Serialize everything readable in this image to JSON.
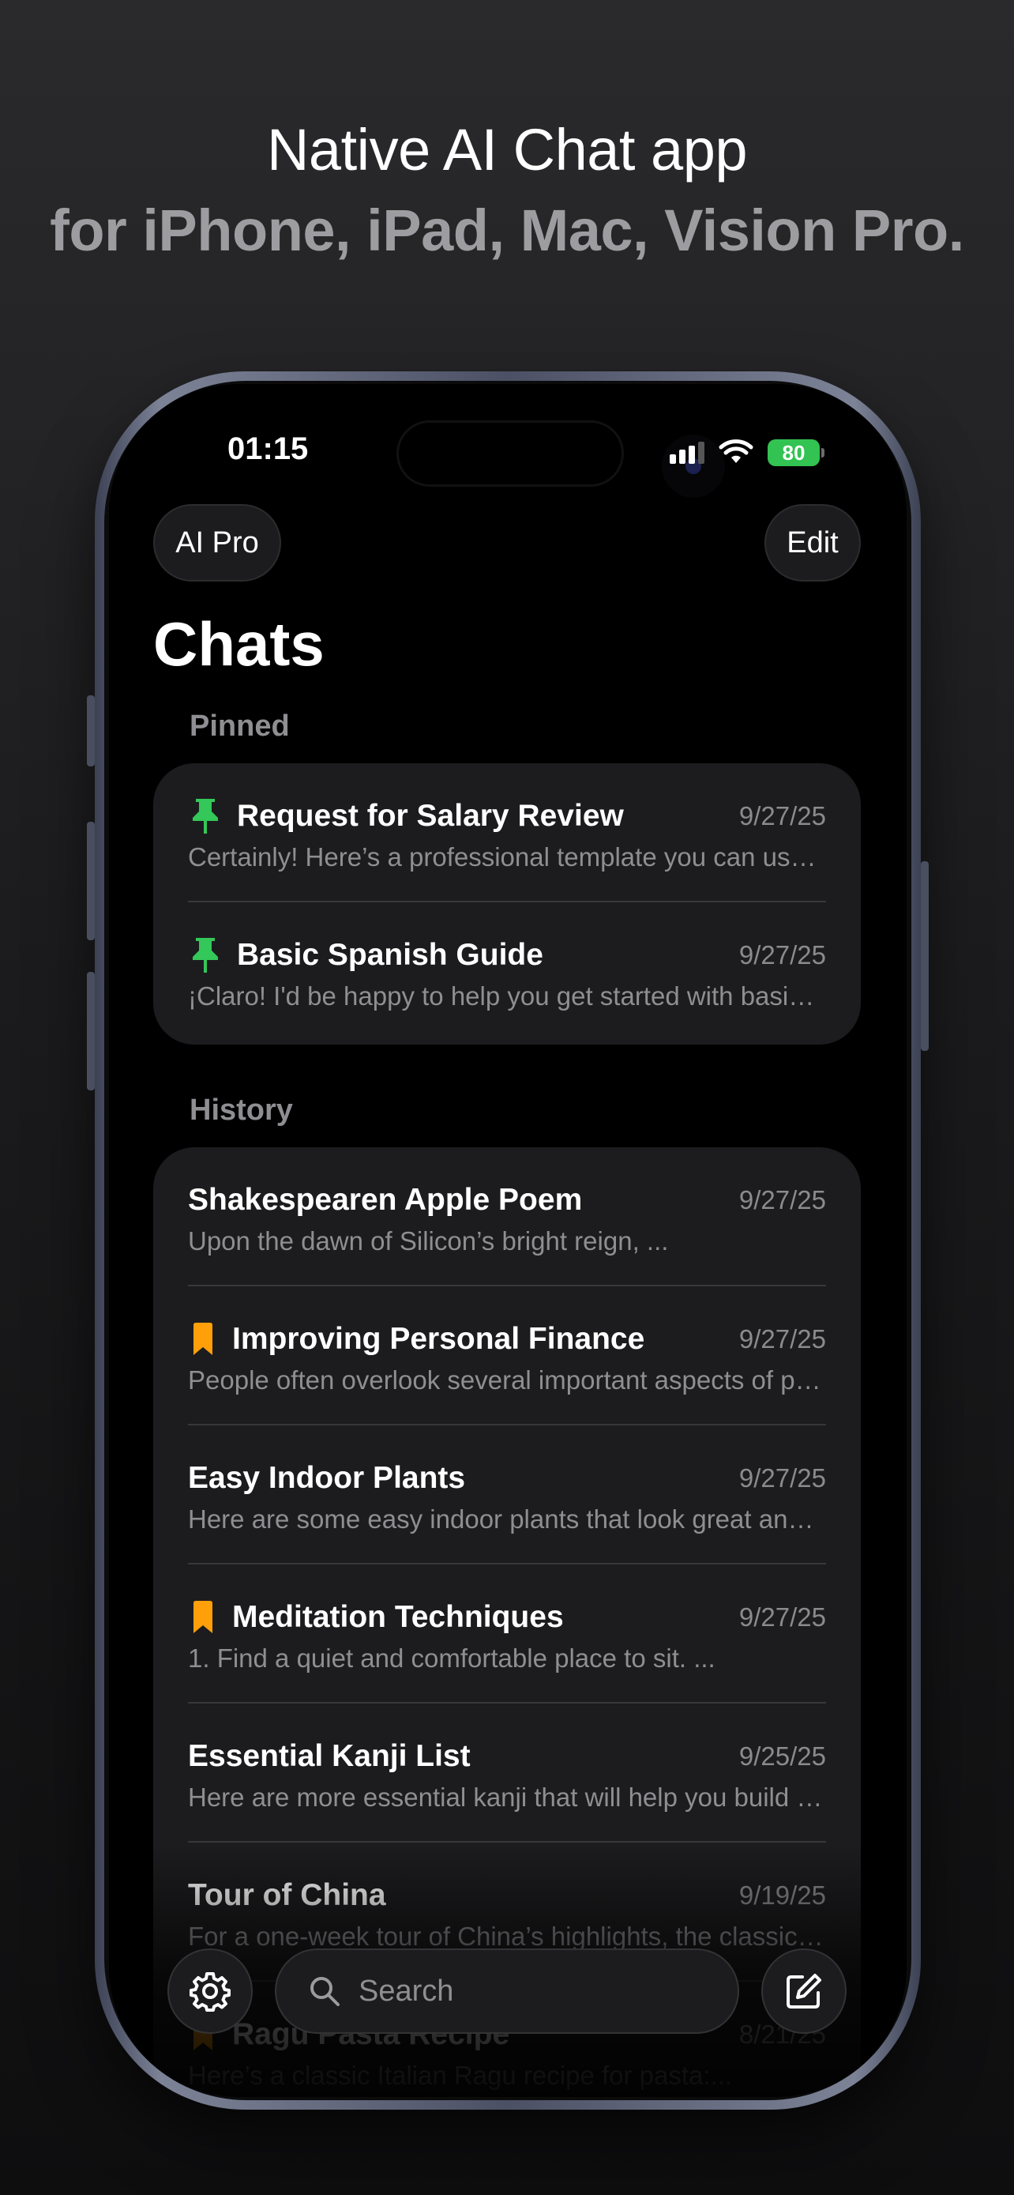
{
  "headline": {
    "line1": "Native AI Chat app",
    "line2": "for iPhone, iPad, Mac, Vision Pro."
  },
  "status_bar": {
    "time": "01:15",
    "battery": "80",
    "icons": [
      "signal-icon",
      "wifi-icon",
      "battery-icon"
    ]
  },
  "nav": {
    "left_button": "AI Pro",
    "right_button": "Edit",
    "title": "Chats"
  },
  "sections": {
    "pinned_label": "Pinned",
    "history_label": "History"
  },
  "pinned": [
    {
      "title": "Request for Salary Review",
      "date": "9/27/25",
      "preview": "Certainly! Here’s a professional template you can use for your request",
      "icon": "pin-icon"
    },
    {
      "title": "Basic Spanish Guide",
      "date": "9/27/25",
      "preview": "¡Claro! I'd be happy to help you get started with basic Spanish phrases",
      "icon": "pin-icon"
    }
  ],
  "history": [
    {
      "title": "Shakespearen Apple Poem",
      "date": "9/27/25",
      "preview": "Upon the dawn of Silicon’s bright reign,  ...",
      "icon": ""
    },
    {
      "title": "Improving Personal Finance",
      "date": "9/27/25",
      "preview": "People often overlook several important aspects of personal finance",
      "icon": "bookmark-icon"
    },
    {
      "title": "Easy Indoor Plants",
      "date": "9/27/25",
      "preview": "Here are some easy indoor plants that look great and need little care",
      "icon": ""
    },
    {
      "title": "Meditation Techniques",
      "date": "9/27/25",
      "preview": "1. Find a quiet and comfortable place to sit.  ...",
      "icon": "bookmark-icon"
    },
    {
      "title": "Essential Kanji List",
      "date": "9/25/25",
      "preview": "Here are more essential kanji that will help you build your vocabulary",
      "icon": ""
    },
    {
      "title": "Tour of China",
      "date": "9/19/25",
      "preview": "For a one-week tour of China’s highlights, the classic route is",
      "icon": ""
    },
    {
      "title": "Ragu Pasta Recipe",
      "date": "8/21/25",
      "preview": "Here’s a classic Italian Ragu recipe for pasta:...",
      "icon": "bookmark-icon"
    }
  ],
  "bottom_bar": {
    "search_placeholder": "Search",
    "settings_icon": "gear-icon",
    "compose_icon": "compose-icon"
  },
  "colors": {
    "pin": "#34c759",
    "bookmark": "#ff9f0a",
    "battery": "#32c352",
    "card": "#1c1c1e"
  }
}
